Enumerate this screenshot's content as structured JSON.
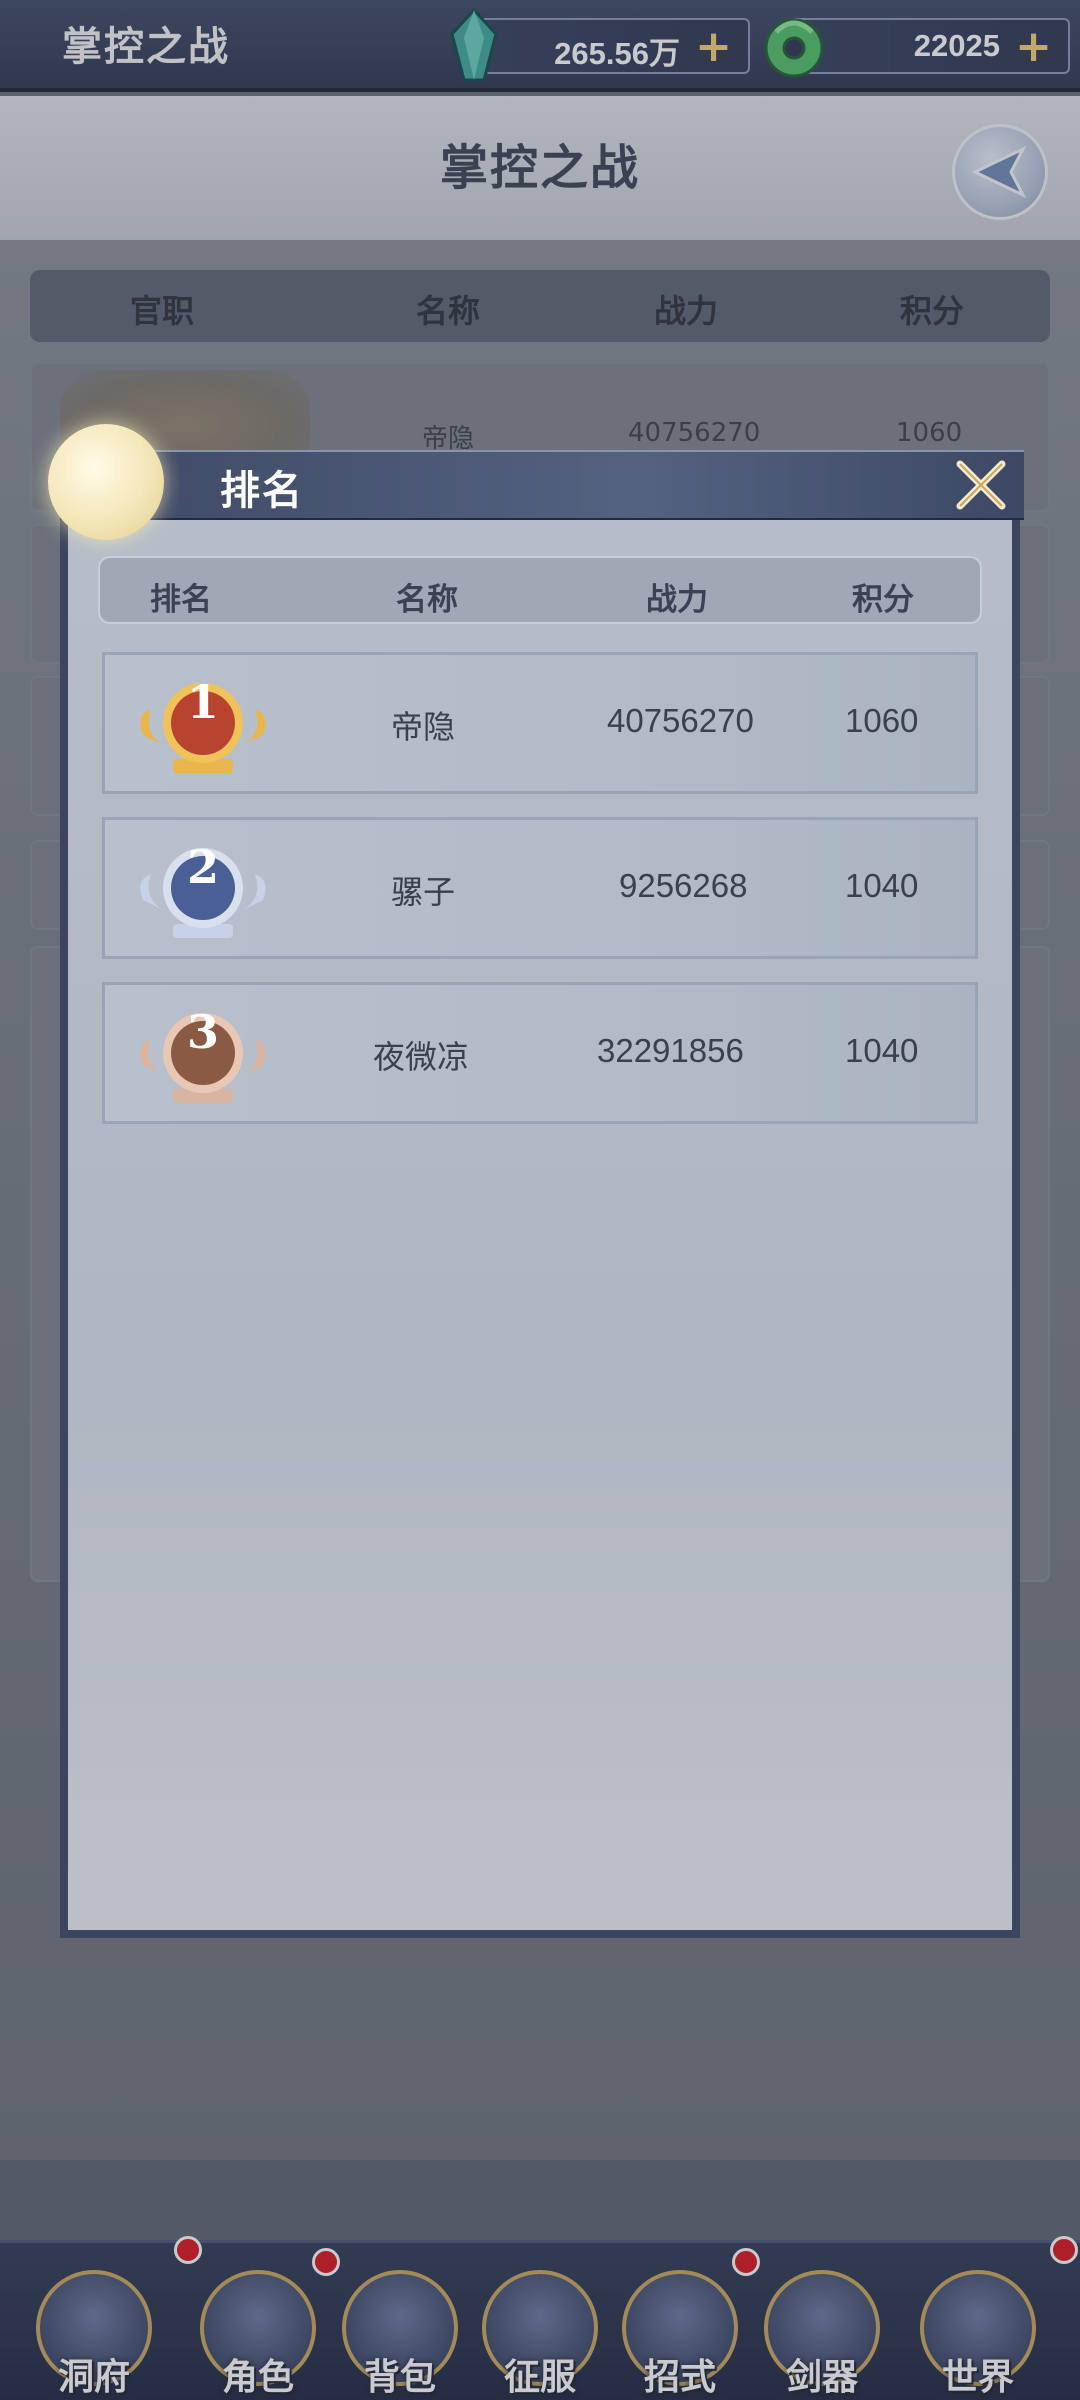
{
  "topbar": {
    "title": "掌控之战",
    "resources": [
      {
        "icon": "crystal-icon",
        "value": "265.56万",
        "plus": "+"
      },
      {
        "icon": "jade-icon",
        "value": "22025",
        "plus": "+"
      }
    ]
  },
  "page": {
    "title": "掌控之战",
    "columns": [
      "官职",
      "名称",
      "战力",
      "积分"
    ],
    "first_row": {
      "name": "帝隐",
      "power": "40756270",
      "score": "1060"
    }
  },
  "modal": {
    "title": "排名",
    "columns": [
      "排名",
      "名称",
      "战力",
      "积分"
    ],
    "rows": [
      {
        "rank": "1",
        "name": "帝隐",
        "power": "40756270",
        "score": "1060",
        "badge_color": "#b8442f"
      },
      {
        "rank": "2",
        "name": "骡子",
        "power": "9256268",
        "score": "1040",
        "badge_color": "#4a5f96"
      },
      {
        "rank": "3",
        "name": "夜微凉",
        "power": "32291856",
        "score": "1040",
        "badge_color": "#8a5a44"
      }
    ]
  },
  "bottom_nav": {
    "items": [
      {
        "label": "洞府",
        "icon": "cave-residence-icon",
        "badge": true
      },
      {
        "label": "角色",
        "icon": "character-icon",
        "badge": true
      },
      {
        "label": "背包",
        "icon": "bag-icon",
        "badge": false
      },
      {
        "label": "征服",
        "icon": "conquer-swords-icon",
        "badge": false
      },
      {
        "label": "招式",
        "icon": "skill-scroll-icon",
        "badge": true
      },
      {
        "label": "剑器",
        "icon": "sword-weapon-icon",
        "badge": false
      },
      {
        "label": "世界",
        "icon": "world-map-icon",
        "badge": true
      }
    ]
  },
  "colors": {
    "accent_gold": "#c9a85e",
    "notification_red": "#d8121c",
    "header_navy": "#3c4864"
  }
}
